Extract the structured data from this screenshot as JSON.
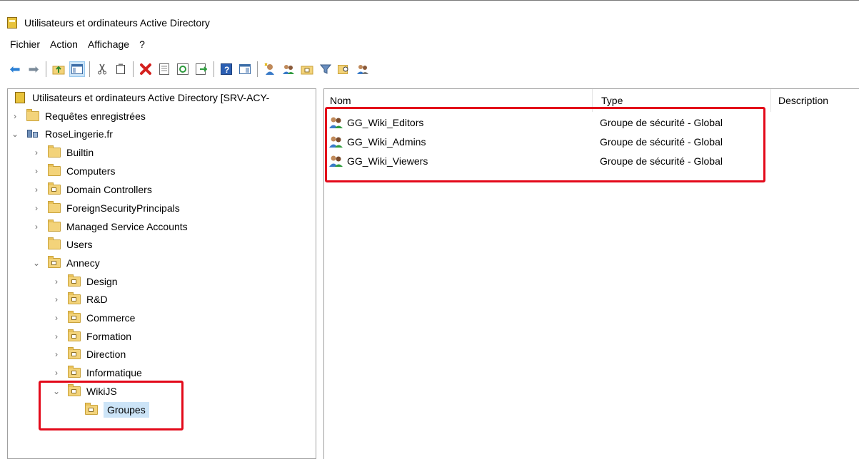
{
  "window": {
    "title": "Utilisateurs et ordinateurs Active Directory"
  },
  "menu": [
    "Fichier",
    "Action",
    "Affichage",
    "?"
  ],
  "toolbar": {
    "icons": [
      "back-icon",
      "forward-icon",
      "up-folder-icon",
      "show-hide-tree-icon",
      "cut-icon",
      "copy-icon",
      "delete-icon",
      "properties-icon",
      "refresh-icon",
      "export-list-icon",
      "help-icon",
      "console-view-icon",
      "new-user-icon",
      "new-group-icon",
      "new-ou-icon",
      "filter-icon",
      "find-icon",
      "add-to-group-icon"
    ]
  },
  "tree": {
    "root": "Utilisateurs et ordinateurs Active Directory [SRV-ACY-",
    "saved_queries": "Requêtes enregistrées",
    "domain": "RoseLingerie.fr",
    "containers": [
      "Builtin",
      "Computers",
      "Domain Controllers",
      "ForeignSecurityPrincipals",
      "Managed Service Accounts",
      "Users"
    ],
    "ou_annecy": "Annecy",
    "annecy_children": [
      "Design",
      "R&D",
      "Commerce",
      "Formation",
      "Direction",
      "Informatique"
    ],
    "ou_wikijs": "WikiJS",
    "ou_groupes": "Groupes"
  },
  "list": {
    "columns": {
      "name": "Nom",
      "type": "Type",
      "description": "Description"
    },
    "rows": [
      {
        "name": "GG_Wiki_Editors",
        "type": "Groupe de sécurité - Global"
      },
      {
        "name": "GG_Wiki_Admins",
        "type": "Groupe de sécurité - Global"
      },
      {
        "name": "GG_Wiki_Viewers",
        "type": "Groupe de sécurité - Global"
      }
    ]
  },
  "colors": {
    "highlight": "#e3091a",
    "selection": "#cce4f7",
    "folder": "#f3d37a"
  }
}
